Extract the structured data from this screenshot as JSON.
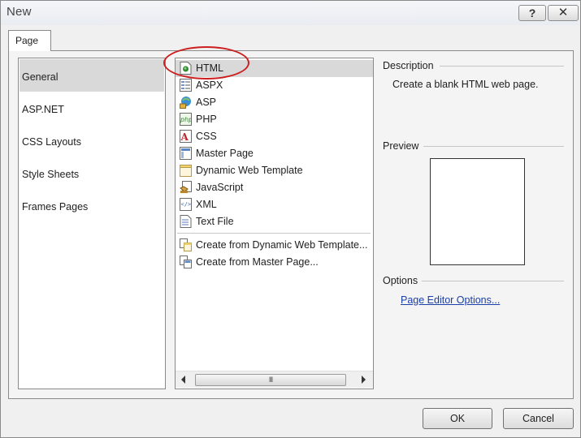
{
  "window": {
    "title": "New",
    "help_label": "?",
    "close_label": "✕"
  },
  "tab": {
    "label": "Page"
  },
  "categories": [
    {
      "label": "General",
      "selected": true
    },
    {
      "label": "ASP.NET",
      "selected": false
    },
    {
      "label": "CSS Layouts",
      "selected": false
    },
    {
      "label": "Style Sheets",
      "selected": false
    },
    {
      "label": "Frames Pages",
      "selected": false
    }
  ],
  "templates": [
    {
      "label": "HTML",
      "icon": "html-file-icon",
      "selected": true
    },
    {
      "label": "ASPX",
      "icon": "aspx-file-icon"
    },
    {
      "label": "ASP",
      "icon": "asp-file-icon"
    },
    {
      "label": "PHP",
      "icon": "php-file-icon"
    },
    {
      "label": "CSS",
      "icon": "css-file-icon"
    },
    {
      "label": "Master Page",
      "icon": "master-page-icon"
    },
    {
      "label": "Dynamic Web Template",
      "icon": "dynamic-web-template-icon"
    },
    {
      "label": "JavaScript",
      "icon": "javascript-file-icon"
    },
    {
      "label": "XML",
      "icon": "xml-file-icon"
    },
    {
      "label": "Text File",
      "icon": "text-file-icon"
    },
    {
      "label": "Create from Dynamic Web Template...",
      "icon": "create-from-dwt-icon"
    },
    {
      "label": "Create from Master Page...",
      "icon": "create-from-master-icon"
    }
  ],
  "scrollbar": {
    "thumb_grip": "III"
  },
  "description": {
    "label": "Description",
    "text": "Create a blank HTML web page."
  },
  "preview": {
    "label": "Preview"
  },
  "options": {
    "label": "Options",
    "link": "Page Editor Options..."
  },
  "buttons": {
    "ok": "OK",
    "cancel": "Cancel"
  },
  "colors": {
    "highlight": "#d9d9d9",
    "annotation_oval": "#cc1f1f",
    "link": "#1a3fa8"
  }
}
